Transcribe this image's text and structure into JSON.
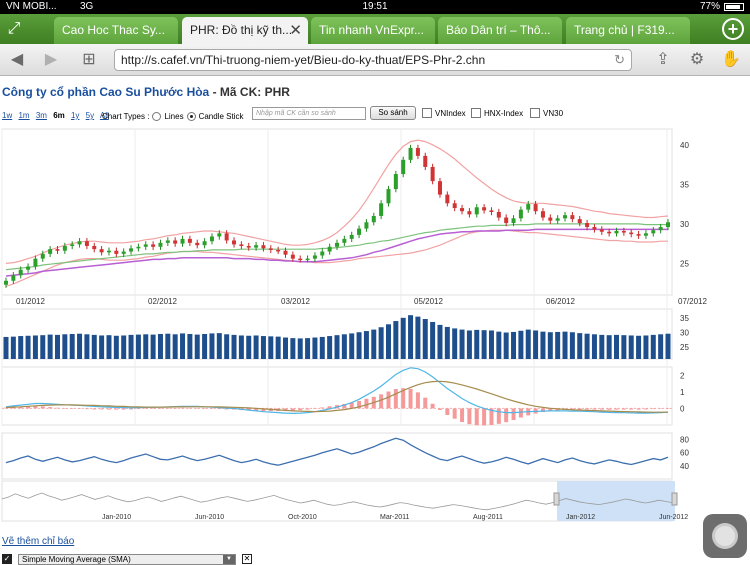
{
  "status": {
    "carrier": "VN MOBI...",
    "network": "3G",
    "time": "19:51",
    "battery": "77%",
    "battery_level": 0.77
  },
  "tabs": [
    {
      "label": "Cao Hoc Thac Sy...",
      "active": false
    },
    {
      "label": "PHR: Đồ thị kỹ th...",
      "active": true
    },
    {
      "label": "Tin nhanh VnExpr...",
      "active": false
    },
    {
      "label": "Báo Dân trí – Thô...",
      "active": false
    },
    {
      "label": "Trang chủ | F319...",
      "active": false
    }
  ],
  "toolbar": {
    "url": "http://s.cafef.vn/Thi-truong-niem-yet/Bieu-do-ky-thuat/EPS-Phr-2.chn"
  },
  "page": {
    "company": "Công ty cổ phần Cao Su Phước Hòa",
    "code_label": " - Mã CK: PHR",
    "ranges": [
      "1w",
      "1m",
      "3m",
      "6m",
      "1y",
      "5y",
      "All"
    ],
    "selected_range": "6m",
    "chart_types_label": "Chart Types :",
    "type_lines": "Lines",
    "type_candle": "Candle Stick",
    "compare_placeholder": "Nhập mã CK cần so sánh",
    "compare_button": "So sánh",
    "indices": [
      "VNIndex",
      "HNX-Index",
      "VN30"
    ],
    "footer_link": "Vẽ thêm chỉ báo",
    "sma_label": "Simple Moving Average (SMA)"
  },
  "chart_data": [
    {
      "type": "candlestick",
      "title": "",
      "x_labels": [
        "01/2012",
        "02/2012",
        "03/2012",
        "05/2012",
        "06/2012",
        "07/2012"
      ],
      "y_ticks": [
        25,
        30,
        35,
        40
      ],
      "ylim": [
        21,
        42
      ],
      "series": [
        {
          "name": "close",
          "values": [
            22.8,
            23.5,
            24.2,
            24.6,
            25.6,
            26.2,
            26.8,
            26.6,
            27.2,
            27.4,
            27.8,
            27.2,
            26.8,
            26.4,
            26.6,
            26.2,
            26.5,
            26.9,
            27.1,
            27.4,
            27.1,
            27.6,
            27.9,
            27.5,
            28.1,
            27.6,
            27.3,
            27.8,
            28.4,
            28.8,
            27.9,
            27.4,
            27.2,
            27.0,
            27.3,
            26.9,
            26.7,
            26.6,
            26.1,
            25.6,
            25.5,
            25.6,
            26.0,
            26.5,
            27.1,
            27.6,
            28.1,
            28.6,
            29.4,
            30.2,
            31.0,
            32.6,
            34.4,
            36.3,
            38.1,
            39.6,
            38.6,
            37.2,
            35.4,
            33.7,
            32.6,
            32.0,
            31.6,
            31.2,
            32.1,
            31.7,
            31.5,
            30.8,
            30.1,
            30.7,
            31.8,
            32.5,
            31.6,
            30.8,
            30.4,
            30.7,
            31.1,
            30.6,
            30.1,
            29.6,
            29.3,
            29.0,
            28.8,
            29.1,
            28.9,
            28.7,
            28.5,
            28.8,
            29.2,
            29.6,
            30.2
          ]
        },
        {
          "name": "BB upper",
          "values": [
            25.0,
            25.1,
            25.3,
            25.6,
            25.9,
            26.3,
            26.7,
            27.0,
            27.3,
            27.5,
            27.7,
            27.8,
            27.8,
            27.7,
            27.6,
            27.6,
            27.6,
            27.7,
            27.8,
            28.0,
            28.1,
            28.3,
            28.5,
            28.6,
            28.8,
            28.9,
            29.0,
            29.1,
            29.1,
            29.0,
            28.9,
            28.8,
            28.6,
            28.4,
            28.2,
            28.0,
            27.8,
            27.6,
            27.4,
            27.3,
            27.3,
            27.4,
            27.6,
            27.9,
            28.3,
            28.9,
            29.7,
            30.6,
            31.7,
            33.0,
            34.5,
            36.0,
            37.5,
            38.8,
            39.8,
            40.4,
            40.6,
            40.4,
            40.0,
            39.5,
            38.9,
            38.2,
            37.4,
            36.6,
            35.8,
            35.1,
            34.4,
            33.8,
            33.3,
            32.9,
            32.7,
            32.6,
            32.6,
            32.6,
            32.5,
            32.4,
            32.3,
            32.2,
            32.0,
            31.8,
            31.6,
            31.5,
            31.3,
            31.2,
            31.1,
            31.0,
            30.9,
            30.8,
            30.8,
            30.9,
            31.0
          ]
        },
        {
          "name": "BB lower",
          "values": [
            22.1,
            22.4,
            22.8,
            23.2,
            23.6,
            24.0,
            24.4,
            24.8,
            25.1,
            25.3,
            25.5,
            25.6,
            25.6,
            25.5,
            25.4,
            25.4,
            25.4,
            25.5,
            25.6,
            25.8,
            25.9,
            26.1,
            26.3,
            26.4,
            26.5,
            26.5,
            26.5,
            26.4,
            26.4,
            26.3,
            26.2,
            26.1,
            26.0,
            25.9,
            25.8,
            25.7,
            25.6,
            25.5,
            25.4,
            25.3,
            25.2,
            25.2,
            25.1,
            25.1,
            25.1,
            25.2,
            25.3,
            25.4,
            25.6,
            25.7,
            25.8,
            25.9,
            26.0,
            26.1,
            26.2,
            26.3,
            26.5,
            26.7,
            27.0,
            27.3,
            27.7,
            28.1,
            28.5,
            28.8,
            29.0,
            29.1,
            29.2,
            29.2,
            29.2,
            29.1,
            29.0,
            28.9,
            28.9,
            28.8,
            28.7,
            28.6,
            28.5,
            28.4,
            28.3,
            28.2,
            28.1,
            28.0,
            27.9,
            27.9,
            27.8,
            27.8,
            27.7,
            27.7,
            27.7,
            27.8,
            27.8
          ]
        },
        {
          "name": "MA long",
          "values": [
            24.2,
            24.3,
            24.4,
            24.5,
            24.6,
            24.8,
            24.9,
            25.0,
            25.1,
            25.2,
            25.3,
            25.4,
            25.5,
            25.6,
            25.7,
            25.8,
            25.9,
            26.0,
            26.1,
            26.2,
            26.2,
            26.3,
            26.4,
            26.4,
            26.5,
            26.5,
            26.6,
            26.6,
            26.7,
            26.7,
            26.7,
            26.7,
            26.8,
            26.8,
            26.8,
            26.8,
            26.8,
            26.8,
            26.8,
            26.8,
            26.8,
            26.8,
            26.8,
            26.9,
            26.9,
            27.0,
            27.1,
            27.2,
            27.3,
            27.5,
            27.6,
            27.8,
            27.9,
            28.1,
            28.3,
            28.5,
            28.7,
            28.9,
            29.0,
            29.2,
            29.3,
            29.4,
            29.5,
            29.6,
            29.7,
            29.7,
            29.8,
            29.8,
            29.8,
            29.9,
            29.9,
            29.9,
            30.0,
            30.0,
            30.0,
            30.0,
            30.0,
            30.0,
            30.0,
            30.0,
            30.0,
            30.0,
            30.0,
            30.0,
            30.0,
            30.0,
            30.0,
            29.9,
            29.9,
            29.9,
            29.9
          ]
        },
        {
          "name": "MA short",
          "values": [
            23.4,
            23.5,
            23.6,
            23.7,
            23.8,
            24.0,
            24.1,
            24.2,
            24.3,
            24.4,
            24.5,
            24.6,
            24.7,
            24.8,
            24.9,
            25.0,
            25.1,
            25.2,
            25.3,
            25.4,
            25.5,
            25.5,
            25.6,
            25.6,
            25.7,
            25.7,
            25.7,
            25.7,
            25.7,
            25.7,
            25.7,
            25.6,
            25.6,
            25.6,
            25.5,
            25.5,
            25.4,
            25.4,
            25.3,
            25.3,
            25.2,
            25.2,
            25.2,
            25.3,
            25.4,
            25.5,
            25.6,
            25.7,
            25.9,
            26.1,
            26.4,
            26.6,
            26.9,
            27.2,
            27.5,
            27.8,
            28.1,
            28.3,
            28.5,
            28.7,
            28.8,
            28.9,
            29.0,
            29.0,
            29.1,
            29.1,
            29.1,
            29.1,
            29.2,
            29.2,
            29.2,
            29.2,
            29.3,
            29.3,
            29.3,
            29.3,
            29.3,
            29.3,
            29.3,
            29.3,
            29.3,
            29.3,
            29.3,
            29.3,
            29.3,
            29.3,
            29.3,
            29.3,
            29.3,
            29.3,
            29.3
          ]
        }
      ]
    },
    {
      "type": "bar",
      "title": "",
      "y_ticks": [
        25,
        30,
        35
      ],
      "ylim": [
        21,
        38
      ],
      "values": [
        28.5,
        28.6,
        28.8,
        28.9,
        29.0,
        29.1,
        29.3,
        29.2,
        29.4,
        29.5,
        29.6,
        29.4,
        29.2,
        29.0,
        29.1,
        28.9,
        29.0,
        29.2,
        29.3,
        29.4,
        29.3,
        29.5,
        29.6,
        29.4,
        29.7,
        29.5,
        29.3,
        29.5,
        29.7,
        29.8,
        29.4,
        29.2,
        29.0,
        28.9,
        29.0,
        28.8,
        28.7,
        28.6,
        28.3,
        28.1,
        28.0,
        28.1,
        28.3,
        28.5,
        28.8,
        29.1,
        29.4,
        29.7,
        30.1,
        30.5,
        31.0,
        31.8,
        32.8,
        33.9,
        35.0,
        35.9,
        35.4,
        34.6,
        33.6,
        32.6,
        31.9,
        31.4,
        31.0,
        30.7,
        30.9,
        30.8,
        30.7,
        30.3,
        30.0,
        30.2,
        30.6,
        31.0,
        30.7,
        30.3,
        30.1,
        30.2,
        30.3,
        30.1,
        29.8,
        29.6,
        29.4,
        29.2,
        29.1,
        29.2,
        29.1,
        29.0,
        28.9,
        29.0,
        29.2,
        29.4,
        29.6
      ]
    },
    {
      "type": "line",
      "title": "",
      "y_ticks": [
        0,
        1,
        2
      ],
      "ylim": [
        -1,
        2.5
      ],
      "series": [
        {
          "name": "MACD",
          "values": [
            0.1,
            0.15,
            0.2,
            0.25,
            0.3,
            0.3,
            0.28,
            0.25,
            0.22,
            0.2,
            0.18,
            0.15,
            0.12,
            0.1,
            0.08,
            0.06,
            0.05,
            0.04,
            0.05,
            0.06,
            0.07,
            0.08,
            0.1,
            0.11,
            0.12,
            0.13,
            0.12,
            0.1,
            0.08,
            0.05,
            0.02,
            0.0,
            -0.05,
            -0.1,
            -0.15,
            -0.2,
            -0.22,
            -0.25,
            -0.28,
            -0.3,
            -0.28,
            -0.25,
            -0.2,
            -0.12,
            -0.03,
            0.08,
            0.2,
            0.35,
            0.55,
            0.8,
            1.05,
            1.35,
            1.7,
            2.05,
            2.3,
            2.45,
            2.4,
            2.2,
            1.9,
            1.55,
            1.2,
            0.9,
            0.6,
            0.35,
            0.15,
            0.0,
            -0.12,
            -0.2,
            -0.25,
            -0.25,
            -0.22,
            -0.2,
            -0.18,
            -0.16,
            -0.15,
            -0.15,
            -0.15,
            -0.16,
            -0.17,
            -0.18,
            -0.2,
            -0.22,
            -0.24,
            -0.25,
            -0.26,
            -0.27,
            -0.28,
            -0.28,
            -0.27,
            -0.25,
            -0.22
          ]
        },
        {
          "name": "Signal",
          "values": [
            0.05,
            0.08,
            0.1,
            0.13,
            0.16,
            0.18,
            0.2,
            0.21,
            0.21,
            0.21,
            0.2,
            0.19,
            0.18,
            0.16,
            0.15,
            0.13,
            0.12,
            0.1,
            0.09,
            0.08,
            0.08,
            0.08,
            0.08,
            0.09,
            0.09,
            0.1,
            0.1,
            0.1,
            0.1,
            0.09,
            0.08,
            0.07,
            0.05,
            0.03,
            0.0,
            -0.03,
            -0.06,
            -0.09,
            -0.12,
            -0.15,
            -0.17,
            -0.18,
            -0.19,
            -0.18,
            -0.16,
            -0.12,
            -0.07,
            0.0,
            0.1,
            0.22,
            0.35,
            0.5,
            0.68,
            0.88,
            1.08,
            1.27,
            1.43,
            1.55,
            1.62,
            1.64,
            1.6,
            1.52,
            1.42,
            1.3,
            1.17,
            1.03,
            0.88,
            0.73,
            0.58,
            0.45,
            0.33,
            0.22,
            0.13,
            0.06,
            0.01,
            -0.03,
            -0.06,
            -0.08,
            -0.1,
            -0.12,
            -0.13,
            -0.15,
            -0.16,
            -0.18,
            -0.19,
            -0.2,
            -0.21,
            -0.22,
            -0.23,
            -0.23,
            -0.23
          ]
        }
      ]
    },
    {
      "type": "line",
      "title": "",
      "y_ticks": [
        40,
        60,
        80
      ],
      "ylim": [
        20,
        90
      ],
      "values": [
        45,
        48,
        52,
        55,
        50,
        47,
        50,
        53,
        49,
        46,
        48,
        51,
        54,
        50,
        47,
        45,
        48,
        52,
        55,
        58,
        54,
        50,
        49,
        52,
        55,
        51,
        48,
        50,
        53,
        56,
        52,
        48,
        45,
        47,
        50,
        46,
        43,
        41,
        44,
        47,
        50,
        53,
        56,
        60,
        63,
        66,
        62,
        58,
        61,
        65,
        69,
        74,
        78,
        82,
        79,
        72,
        66,
        60,
        55,
        50,
        48,
        52,
        55,
        51,
        47,
        44,
        46,
        49,
        53,
        50,
        46,
        43,
        47,
        51,
        48,
        45,
        49,
        52,
        48,
        45,
        43,
        46,
        49,
        47,
        44,
        42,
        45,
        48,
        51,
        49,
        53
      ]
    },
    {
      "type": "area",
      "title": "",
      "x_labels": [
        "Jan-2010",
        "Jun-2010",
        "Oct-2010",
        "Mar-2011",
        "Aug-2011",
        "Jan-2012",
        "Jun-2012"
      ],
      "values": [
        55,
        60,
        68,
        62,
        57,
        64,
        70,
        63,
        58,
        52,
        56,
        61,
        66,
        60,
        54,
        58,
        63,
        57,
        52,
        48,
        51,
        56,
        60,
        55,
        49,
        53,
        58,
        62,
        57,
        52,
        47,
        50,
        54,
        58,
        61,
        57,
        53,
        49,
        52,
        56,
        60,
        64,
        58,
        53,
        49,
        45,
        48,
        52,
        47,
        42,
        39,
        41,
        45,
        48,
        44,
        40,
        37,
        35,
        38,
        42,
        46,
        44,
        40,
        37,
        34,
        32,
        35,
        38,
        41,
        39,
        36,
        33,
        30,
        28,
        31,
        34,
        38,
        42,
        47,
        52,
        49,
        45,
        42,
        46,
        51,
        56,
        52,
        48,
        45,
        43,
        41,
        44,
        47,
        51,
        55,
        52,
        48,
        45,
        48,
        52,
        49,
        46
      ],
      "selection_range": [
        "Jan-2012",
        "Jun-2012"
      ]
    }
  ]
}
